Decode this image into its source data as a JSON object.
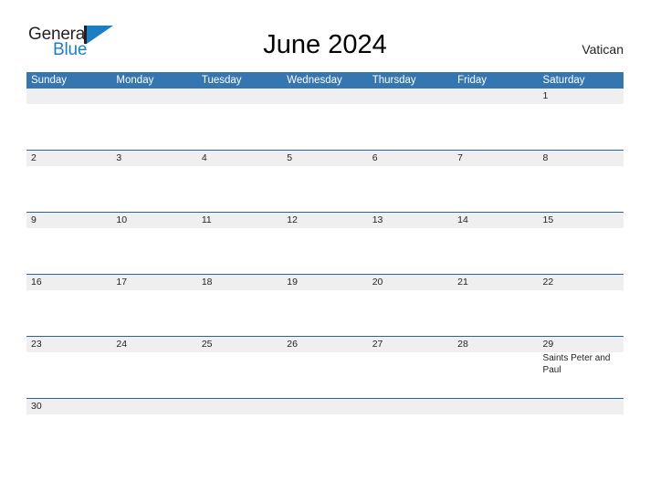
{
  "brand": {
    "name_top": "General",
    "name_bottom": "Blue",
    "triangle_icon": "blue-triangle-icon",
    "accent_color": "#1c7fc4",
    "text_color": "#231f20"
  },
  "header": {
    "title": "June 2024",
    "country": "Vatican"
  },
  "calendar": {
    "header_bg": "#3575b0",
    "band_bg": "#efefef",
    "rule_color": "#2b6298",
    "weekdays": [
      "Sunday",
      "Monday",
      "Tuesday",
      "Wednesday",
      "Thursday",
      "Friday",
      "Saturday"
    ],
    "weeks": [
      [
        {
          "day": ""
        },
        {
          "day": ""
        },
        {
          "day": ""
        },
        {
          "day": ""
        },
        {
          "day": ""
        },
        {
          "day": ""
        },
        {
          "day": "1",
          "events": []
        }
      ],
      [
        {
          "day": "2",
          "events": []
        },
        {
          "day": "3",
          "events": []
        },
        {
          "day": "4",
          "events": []
        },
        {
          "day": "5",
          "events": []
        },
        {
          "day": "6",
          "events": []
        },
        {
          "day": "7",
          "events": []
        },
        {
          "day": "8",
          "events": []
        }
      ],
      [
        {
          "day": "9",
          "events": []
        },
        {
          "day": "10",
          "events": []
        },
        {
          "day": "11",
          "events": []
        },
        {
          "day": "12",
          "events": []
        },
        {
          "day": "13",
          "events": []
        },
        {
          "day": "14",
          "events": []
        },
        {
          "day": "15",
          "events": []
        }
      ],
      [
        {
          "day": "16",
          "events": []
        },
        {
          "day": "17",
          "events": []
        },
        {
          "day": "18",
          "events": []
        },
        {
          "day": "19",
          "events": []
        },
        {
          "day": "20",
          "events": []
        },
        {
          "day": "21",
          "events": []
        },
        {
          "day": "22",
          "events": []
        }
      ],
      [
        {
          "day": "23",
          "events": []
        },
        {
          "day": "24",
          "events": []
        },
        {
          "day": "25",
          "events": []
        },
        {
          "day": "26",
          "events": []
        },
        {
          "day": "27",
          "events": []
        },
        {
          "day": "28",
          "events": []
        },
        {
          "day": "29",
          "events": [
            "Saints Peter and Paul"
          ]
        }
      ],
      [
        {
          "day": "30",
          "events": []
        },
        {
          "day": ""
        },
        {
          "day": ""
        },
        {
          "day": ""
        },
        {
          "day": ""
        },
        {
          "day": ""
        },
        {
          "day": ""
        }
      ]
    ]
  }
}
